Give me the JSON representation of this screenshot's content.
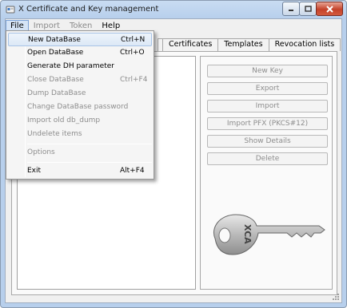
{
  "window": {
    "title": "X Certificate and Key management"
  },
  "menubar": {
    "items": [
      {
        "label": "File",
        "active": true
      },
      {
        "label": "Import",
        "disabled": true
      },
      {
        "label": "Token",
        "disabled": true
      },
      {
        "label": "Help"
      }
    ]
  },
  "file_menu": {
    "items": [
      {
        "label": "New DataBase",
        "shortcut": "Ctrl+N",
        "enabled": true,
        "highlighted": true
      },
      {
        "label": "Open DataBase",
        "shortcut": "Ctrl+O",
        "enabled": true
      },
      {
        "label": "Generate DH parameter",
        "shortcut": "",
        "enabled": true
      },
      {
        "label": "Close DataBase",
        "shortcut": "Ctrl+F4",
        "enabled": false
      },
      {
        "label": "Dump DataBase",
        "shortcut": "",
        "enabled": false
      },
      {
        "label": "Change DataBase password",
        "shortcut": "",
        "enabled": false
      },
      {
        "label": "Import old db_dump",
        "shortcut": "",
        "enabled": false
      },
      {
        "label": "Undelete items",
        "shortcut": "",
        "enabled": false
      },
      {
        "label": "Options",
        "shortcut": "",
        "enabled": false
      },
      {
        "label": "Exit",
        "shortcut": "Alt+F4",
        "enabled": true
      }
    ]
  },
  "tabs": [
    {
      "label": "Certificates"
    },
    {
      "label": "Templates"
    },
    {
      "label": "Revocation lists"
    }
  ],
  "actions": {
    "buttons": [
      {
        "label": "New Key",
        "mnemonic": "N"
      },
      {
        "label": "Export",
        "mnemonic": "E"
      },
      {
        "label": "Import",
        "mnemonic": "I"
      },
      {
        "label": "Import PFX (PKCS#12)",
        "mnemonic": ""
      },
      {
        "label": "Show Details",
        "mnemonic": "S"
      },
      {
        "label": "Delete",
        "mnemonic": "D"
      }
    ]
  },
  "key_graphic": {
    "engraving": "XCA",
    "icon": "key-icon"
  },
  "colors": {
    "window_frame": "#b7cfec",
    "menu_highlight": "#dce8f6",
    "close_button": "#c4422a",
    "disabled_text": "#8d8d8d"
  }
}
